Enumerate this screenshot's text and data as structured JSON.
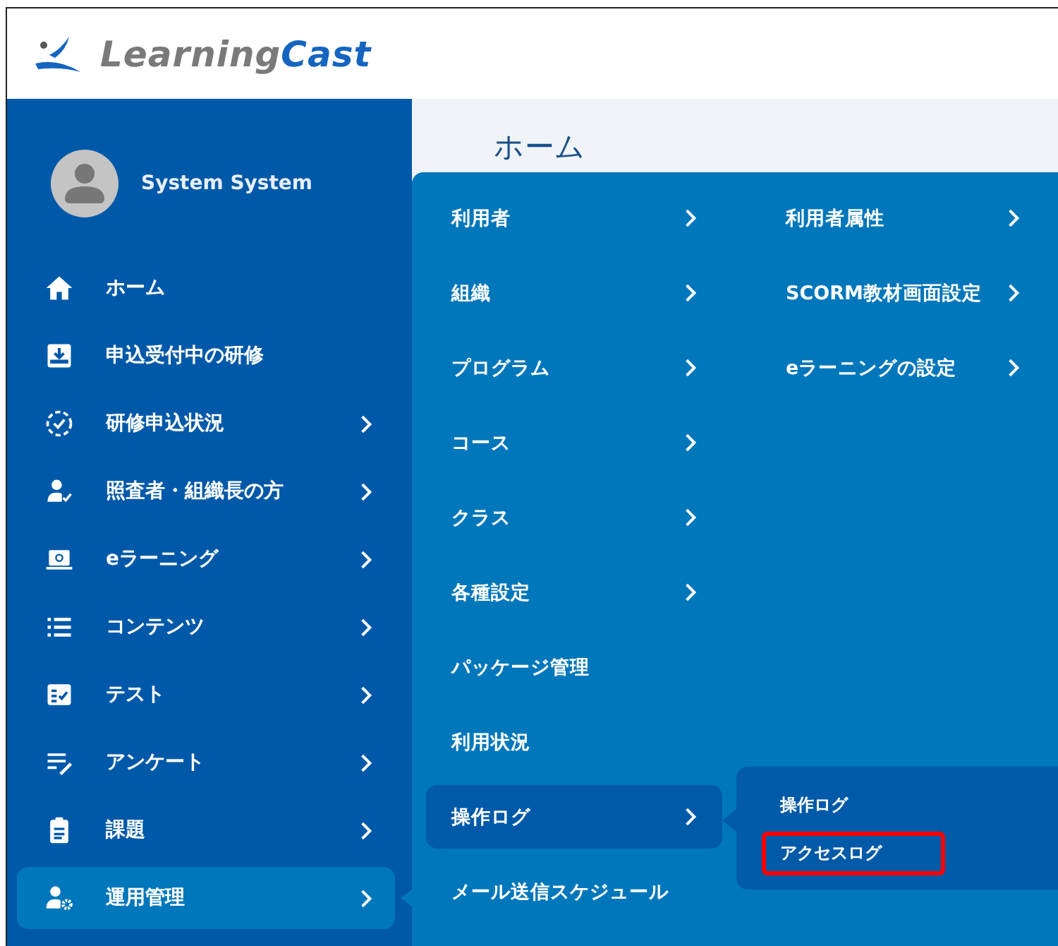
{
  "header": {
    "logo": {
      "prefix": "Learning",
      "suffix": "Cast"
    }
  },
  "sidebar": {
    "user_name": "System System",
    "items": [
      {
        "label": "ホーム",
        "kind": "home",
        "has_submenu": false,
        "selected": false
      },
      {
        "label": "申込受付中の研修",
        "kind": "inbox",
        "has_submenu": false,
        "selected": false
      },
      {
        "label": "研修申込状況",
        "kind": "dashcheck",
        "has_submenu": true,
        "selected": false
      },
      {
        "label": "照査者・組織長の方",
        "kind": "personcheck",
        "has_submenu": true,
        "selected": false
      },
      {
        "label": "eラーニング",
        "kind": "laptop",
        "has_submenu": true,
        "selected": false
      },
      {
        "label": "コンテンツ",
        "kind": "list",
        "has_submenu": true,
        "selected": false
      },
      {
        "label": "テスト",
        "kind": "test",
        "has_submenu": true,
        "selected": false
      },
      {
        "label": "アンケート",
        "kind": "listpen",
        "has_submenu": true,
        "selected": false
      },
      {
        "label": "課題",
        "kind": "clipboard",
        "has_submenu": true,
        "selected": false
      },
      {
        "label": "運用管理",
        "kind": "persongear",
        "has_submenu": true,
        "selected": true
      }
    ]
  },
  "page_title": "ホーム",
  "flyout": {
    "items": [
      {
        "label": "利用者",
        "has_submenu": true,
        "selected": false
      },
      {
        "label": "組織",
        "has_submenu": true,
        "selected": false
      },
      {
        "label": "プログラム",
        "has_submenu": true,
        "selected": false
      },
      {
        "label": "コース",
        "has_submenu": true,
        "selected": false
      },
      {
        "label": "クラス",
        "has_submenu": true,
        "selected": false
      },
      {
        "label": "各種設定",
        "has_submenu": true,
        "selected": false
      },
      {
        "label": "パッケージ管理",
        "has_submenu": false,
        "selected": false
      },
      {
        "label": "利用状況",
        "has_submenu": false,
        "selected": false
      },
      {
        "label": "操作ログ",
        "has_submenu": true,
        "selected": true
      },
      {
        "label": "メール送信スケジュール",
        "has_submenu": false,
        "selected": false
      }
    ],
    "second_column": [
      {
        "label": "利用者属性",
        "has_submenu": true
      },
      {
        "label": "SCORM教材画面設定",
        "has_submenu": true
      },
      {
        "label": "eラーニングの設定",
        "has_submenu": true
      }
    ],
    "submenu": [
      {
        "label": "操作ログ",
        "highlighted": false
      },
      {
        "label": "アクセスログ",
        "highlighted": true
      }
    ]
  }
}
